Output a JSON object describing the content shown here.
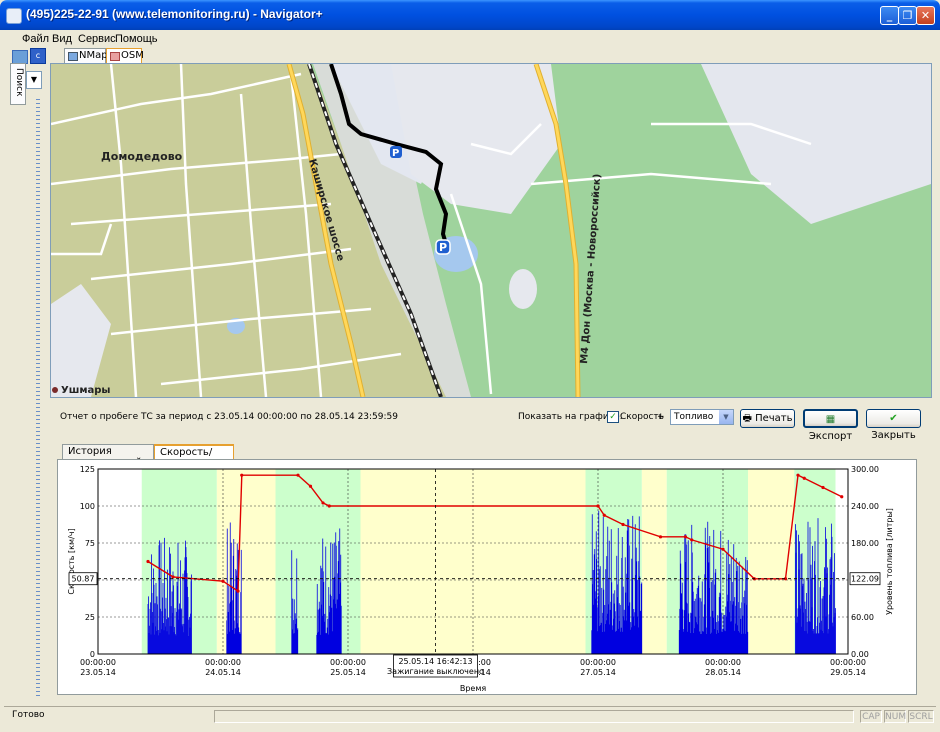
{
  "window": {
    "title": "(495)225-22-91  (www.telemonitoring.ru) - Navigator+"
  },
  "menu": [
    "Файл",
    "Вид",
    "Сервис",
    "Помощь"
  ],
  "side": {
    "search_tab": "Поиск"
  },
  "map": {
    "tabs": [
      "NMap",
      "OSM"
    ],
    "labels": {
      "city": "Домодедово",
      "road1": "Каширское шоссе",
      "road2": "М4 Дон (Москва - Новороссийск)",
      "village": "Ушмары"
    },
    "parking": [
      "P",
      "P"
    ]
  },
  "report": {
    "title": "Отчет о пробеге ТС  за период с 23.05.14 00:00:00 по 28.05.14 23:59:59",
    "show_label": "Показать на графике:",
    "speed_checkbox_label": "Скорость",
    "plus": "+",
    "fuel_select_value": "Топливо",
    "print_button": "Печать",
    "export_button": "Экспорт",
    "close_button": "Закрыть"
  },
  "subtabs": [
    "История перемещений",
    "Скорость/Топливо"
  ],
  "chart_data": {
    "type": "line",
    "xlabel": "Время",
    "ylabel_left": "Скорость [км/ч]",
    "ylabel_right": "Уровень топлива [литры]",
    "y_left_ticks": [
      "125",
      "100",
      "75",
      "50",
      "25",
      "0"
    ],
    "y_right_ticks": [
      "300.00",
      "240.00",
      "180.00",
      "120.00",
      "60.00",
      "0.00"
    ],
    "x_ticks": [
      {
        "time": "00:00:00",
        "date": "23.05.14"
      },
      {
        "time": "00:00:00",
        "date": "24.05.14"
      },
      {
        "time": "00:00:00",
        "date": "25.05.14"
      },
      {
        "time": "00:00:00",
        "date": "26.05.14"
      },
      {
        "time": "00:00:00",
        "date": "27.05.14"
      },
      {
        "time": "00:00:00",
        "date": "28.05.14"
      },
      {
        "time": "00:00:00",
        "date": "29.05.14"
      }
    ],
    "ylim_left": [
      0,
      125
    ],
    "ylim_right": [
      0,
      300
    ],
    "cursor": {
      "left_value": "50.87",
      "right_value": "122.09",
      "time_label": "25.05.14 16:42:13",
      "status_label": "Зажигание выключено"
    },
    "fuel_series": {
      "color": "#e00000",
      "x_days": [
        0.4,
        0.6,
        1.0,
        1.12,
        1.15,
        1.6,
        1.7,
        1.8,
        1.85,
        4.0,
        4.05,
        4.2,
        4.5,
        4.7,
        4.75,
        5.0,
        5.25,
        5.5,
        5.6,
        5.65,
        5.8,
        5.95
      ],
      "values": [
        150,
        125,
        118,
        102,
        290,
        290,
        272,
        245,
        240,
        240,
        225,
        210,
        190,
        190,
        185,
        170,
        122,
        122,
        290,
        285,
        270,
        255
      ]
    },
    "speed_series": {
      "color": "#0000e0"
    },
    "colors": {
      "ignition_on": "#ccffcc",
      "ignition_off": "#ffffcc",
      "fuel": "#e00000",
      "speed": "#0000e0"
    }
  },
  "status": {
    "text": "Готово",
    "indicators": [
      "CAP",
      "NUM",
      "SCRL"
    ]
  }
}
